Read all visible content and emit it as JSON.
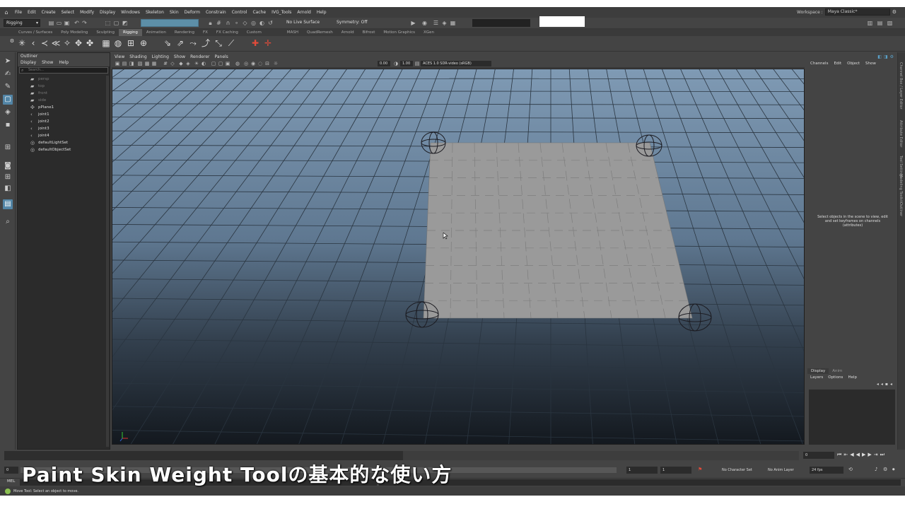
{
  "menubar": {
    "items": [
      "File",
      "Edit",
      "Create",
      "Select",
      "Modify",
      "Display",
      "Windows",
      "Skeleton",
      "Skin",
      "Deform",
      "Constrain",
      "Control",
      "Cache",
      "IVG_Tools",
      "Arnold",
      "Help"
    ],
    "workspace_label": "Workspace :",
    "workspace_value": "Maya Classic*"
  },
  "statusline": {
    "menuset": "Rigging",
    "live_surface": "No Live Surface",
    "symmetry": "Symmetry: Off"
  },
  "shelf_tabs": [
    "Curves / Surfaces",
    "Poly Modeling",
    "Sculpting",
    "Rigging",
    "Animation",
    "Rendering",
    "FX",
    "FX Caching",
    "Custom",
    "MASH",
    "QuadRemesh",
    "Arnold",
    "Bifrost",
    "Motion Graphics",
    "XGen"
  ],
  "shelf_active_tab": "Rigging",
  "outliner": {
    "title": "Outliner",
    "menu": [
      "Display",
      "Show",
      "Help"
    ],
    "search_placeholder": "Search...",
    "rows": [
      {
        "label": "persp",
        "icon": "camera-icon",
        "dim": true
      },
      {
        "label": "top",
        "icon": "camera-icon",
        "dim": true
      },
      {
        "label": "front",
        "icon": "camera-icon",
        "dim": true
      },
      {
        "label": "side",
        "icon": "camera-icon",
        "dim": true
      },
      {
        "label": "pPlane1",
        "icon": "mesh-icon",
        "dim": false
      },
      {
        "label": "joint1",
        "icon": "joint-icon",
        "dim": false
      },
      {
        "label": "joint2",
        "icon": "joint-icon",
        "dim": false
      },
      {
        "label": "joint3",
        "icon": "joint-icon",
        "dim": false
      },
      {
        "label": "joint4",
        "icon": "joint-icon",
        "dim": false
      },
      {
        "label": "defaultLightSet",
        "icon": "set-icon",
        "dim": false
      },
      {
        "label": "defaultObjectSet",
        "icon": "set-icon",
        "dim": false
      }
    ]
  },
  "viewport": {
    "menu": [
      "View",
      "Shading",
      "Lighting",
      "Show",
      "Renderer",
      "Panels"
    ],
    "exposure": "0.00",
    "gamma": "1.00",
    "colorspace": "ACES 1.0 SDR-video (sRGB)"
  },
  "channelbox": {
    "menu": [
      "Channels",
      "Edit",
      "Object",
      "Show"
    ],
    "message": "Select objects in the scene to view, edit and set keyframes on channels (attributes)"
  },
  "side_tabs": [
    "Channel Box / Layer Editor",
    "Attribute Editor",
    "Tool Settings",
    "Modeling Toolkit",
    "Outliner"
  ],
  "layer_editor": {
    "tabs": [
      "Display",
      "Anim"
    ],
    "menu": [
      "Layers",
      "Options",
      "Help"
    ]
  },
  "timeline": {
    "current_frame": "0"
  },
  "rangebar": {
    "start": "0",
    "range_start": "1",
    "range_end": "1",
    "character_set": "No Character Set",
    "anim_layer": "No Anim Layer",
    "fps": "24 fps"
  },
  "melbar": {
    "label": "MEL"
  },
  "helpline": {
    "text": "Move Tool: Select an object to move."
  },
  "caption": "Paint Skin Weight Toolの基本的な使い方",
  "colors": {
    "accent": "#5285a6",
    "plane": "#9a9a9a",
    "viewport_top": "#7e98b2",
    "viewport_bottom": "#151b22"
  }
}
